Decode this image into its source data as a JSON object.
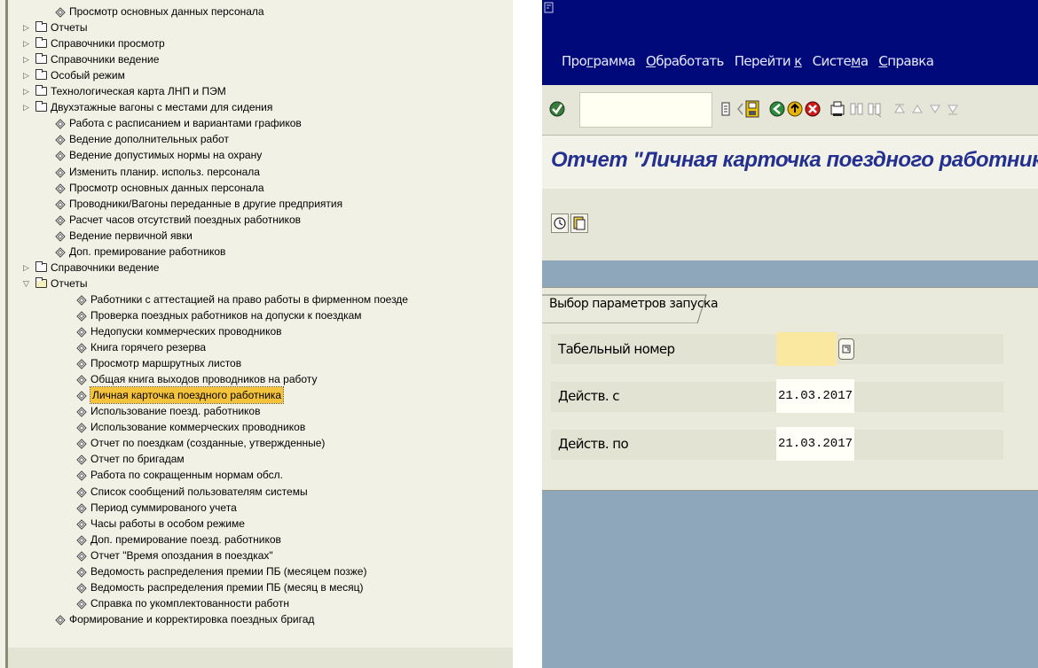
{
  "tree": {
    "items": [
      {
        "level": 2,
        "icon": "node",
        "label": "Просмотр основных данных персонала"
      },
      {
        "level": 1,
        "icon": "folder",
        "expander": "closed",
        "label": "Отчеты"
      },
      {
        "level": 1,
        "icon": "folder",
        "expander": "closed",
        "label": "Справочники просмотр"
      },
      {
        "level": 1,
        "icon": "folder",
        "expander": "closed",
        "label": "Справочники ведение"
      },
      {
        "level": 1,
        "icon": "folder",
        "expander": "closed",
        "label": "Особый режим"
      },
      {
        "level": 1,
        "icon": "folder",
        "expander": "closed",
        "label": "Технологическая карта ЛНП и ПЭМ"
      },
      {
        "level": 1,
        "icon": "folder",
        "expander": "closed",
        "label": "Двухэтажные вагоны с местами для сидения"
      },
      {
        "level": 2,
        "icon": "node",
        "label": "Работа с расписанием и вариантами графиков"
      },
      {
        "level": 2,
        "icon": "node",
        "label": "Ведение дополнительных работ"
      },
      {
        "level": 2,
        "icon": "node",
        "label": "Ведение допустимых нормы на охрану"
      },
      {
        "level": 2,
        "icon": "node",
        "label": "Изменить планир. использ. персонала"
      },
      {
        "level": 2,
        "icon": "node",
        "label": "Просмотр основных данных персонала"
      },
      {
        "level": 2,
        "icon": "node",
        "label": "Проводники/Вагоны переданные в другие  предприятия"
      },
      {
        "level": 2,
        "icon": "node",
        "label": "Расчет часов отсутствий поездных работников"
      },
      {
        "level": 2,
        "icon": "node",
        "label": "Ведение первичной явки"
      },
      {
        "level": 2,
        "icon": "node",
        "label": "Доп. премирование работников"
      },
      {
        "level": 1,
        "icon": "folder",
        "expander": "closed",
        "label": "Справочники ведение"
      },
      {
        "level": 1,
        "icon": "folder-open",
        "expander": "open",
        "label": "Отчеты"
      },
      {
        "level": 3,
        "icon": "node",
        "label": "Работники с аттестацией на право работы в фирменном поезде"
      },
      {
        "level": 3,
        "icon": "node",
        "label": "Проверка поездных работников на допуски к поездкам"
      },
      {
        "level": 3,
        "icon": "node",
        "label": "Недопуски коммерческих проводников"
      },
      {
        "level": 3,
        "icon": "node",
        "label": "Книга горячего резерва"
      },
      {
        "level": 3,
        "icon": "node",
        "label": "Просмотр маршрутных листов"
      },
      {
        "level": 3,
        "icon": "node",
        "label": "Общая книга выходов проводников на работу"
      },
      {
        "level": 3,
        "icon": "node",
        "label": "Личная карточка поездного работника",
        "selected": true
      },
      {
        "level": 3,
        "icon": "node",
        "label": "Использование поезд. работников"
      },
      {
        "level": 3,
        "icon": "node",
        "label": "Использование коммерческих проводников"
      },
      {
        "level": 3,
        "icon": "node",
        "label": "Отчет по поездкам (созданные, утвержденные)"
      },
      {
        "level": 3,
        "icon": "node",
        "label": "Отчет по бригадам"
      },
      {
        "level": 3,
        "icon": "node",
        "label": "Работа по сокращенным нормам обсл."
      },
      {
        "level": 3,
        "icon": "node",
        "label": "Список сообщений пользователям системы"
      },
      {
        "level": 3,
        "icon": "node",
        "label": "Период суммированого учета"
      },
      {
        "level": 3,
        "icon": "node",
        "label": "Часы работы в особом режиме"
      },
      {
        "level": 3,
        "icon": "node",
        "label": "Доп. премирование поезд. работников"
      },
      {
        "level": 3,
        "icon": "node",
        "label": "Отчет \"Время опоздания в поездках\""
      },
      {
        "level": 3,
        "icon": "node",
        "label": "Ведомость распределения премии ПБ (месяцем позже)"
      },
      {
        "level": 3,
        "icon": "node",
        "label": "Ведомость распределения премии ПБ (месяц в месяц)"
      },
      {
        "level": 3,
        "icon": "node",
        "label": "Справка по укомплектованности работн"
      },
      {
        "level": 2,
        "icon": "node",
        "label": "Формирование и корректировка поездных бригад"
      }
    ]
  },
  "sap": {
    "menu": [
      {
        "pre": "Про",
        "u": "г",
        "post": "рамма"
      },
      {
        "pre": "",
        "u": "О",
        "post": "бработать"
      },
      {
        "pre": "Перейти ",
        "u": "к",
        "post": ""
      },
      {
        "pre": "Систе",
        "u": "м",
        "post": "а"
      },
      {
        "pre": "",
        "u": "С",
        "post": "правка"
      }
    ],
    "report_title": "Отчет \"Личная карточка поездного работника\"",
    "group_title": "Выбор параметров запуска",
    "fields": {
      "pernr_label": "Табельный номер",
      "pernr_value": "",
      "date_from_label": "Действ. с",
      "date_from_value": "21.03.2017",
      "date_to_label": "Действ. по",
      "date_to_value": "21.03.2017"
    },
    "colors": {
      "title_bar": "#00097a",
      "report_title": "#23308f",
      "background": "#8ea7bb",
      "selected_item": "#f5c33b",
      "required_field": "#fbe8a0"
    }
  }
}
